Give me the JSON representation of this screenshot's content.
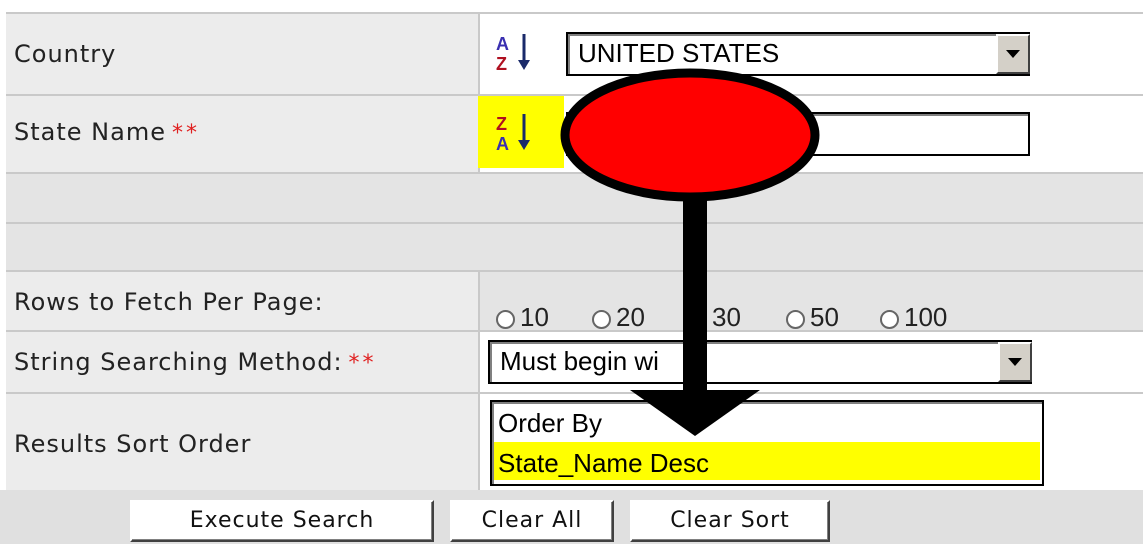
{
  "form": {
    "country_label": "Country",
    "country_value": "UNITED STATES",
    "state_label": "State Name",
    "required_mark": "**",
    "rows_label": "Rows to Fetch Per Page:",
    "rows_options": [
      "10",
      "20",
      "30",
      "50",
      "100"
    ],
    "string_label": "String Searching Method:",
    "string_value": "Must begin wi",
    "sort_label": "Results Sort Order",
    "sort_options": [
      "Order By",
      "State_Name Desc"
    ]
  },
  "buttons": {
    "execute": "Execute Search",
    "clear_all": "Clear All",
    "clear_sort": "Clear Sort"
  },
  "icons": {
    "country_sort": "sort-ascending-icon",
    "state_sort": "sort-descending-icon"
  },
  "colors": {
    "highlight": "#ffff00",
    "annotation_red": "#ff0000",
    "required": "#e02020"
  }
}
